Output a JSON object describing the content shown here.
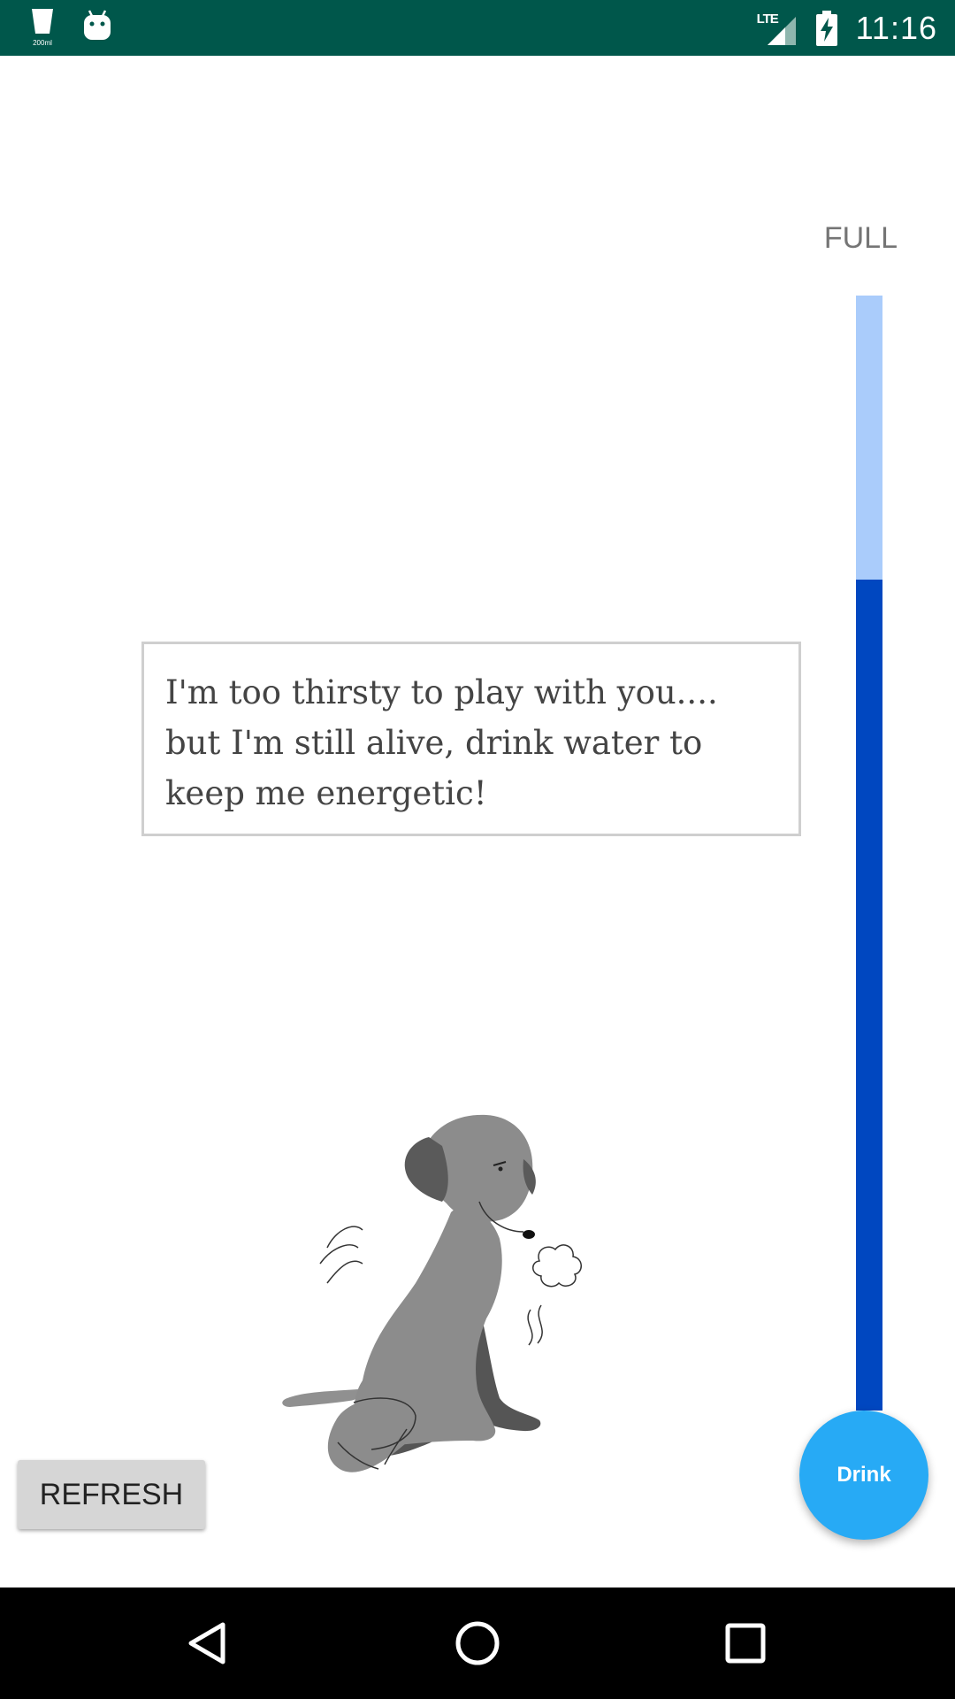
{
  "status_bar": {
    "cup_label": "200ml",
    "network_label": "LTE",
    "time": "11:16",
    "icons": [
      "cup-icon",
      "android-icon",
      "lte-signal-icon",
      "battery-charging-icon"
    ],
    "background_color": "#00574b"
  },
  "water_meter": {
    "label": "FULL",
    "fill_fraction": 0.745,
    "fill_color": "#0047c0",
    "empty_color": "#aaccfb"
  },
  "message": {
    "text": "I'm too thirsty to play with you.... but I'm still alive, drink water to keep me energetic!"
  },
  "dog": {
    "icon": "thirsty-dog-illustration"
  },
  "buttons": {
    "refresh_label": "REFRESH",
    "drink_label": "Drink",
    "drink_color": "#27aaf5"
  },
  "nav_bar": {
    "icons": [
      "back-icon",
      "home-icon",
      "recents-icon"
    ]
  }
}
